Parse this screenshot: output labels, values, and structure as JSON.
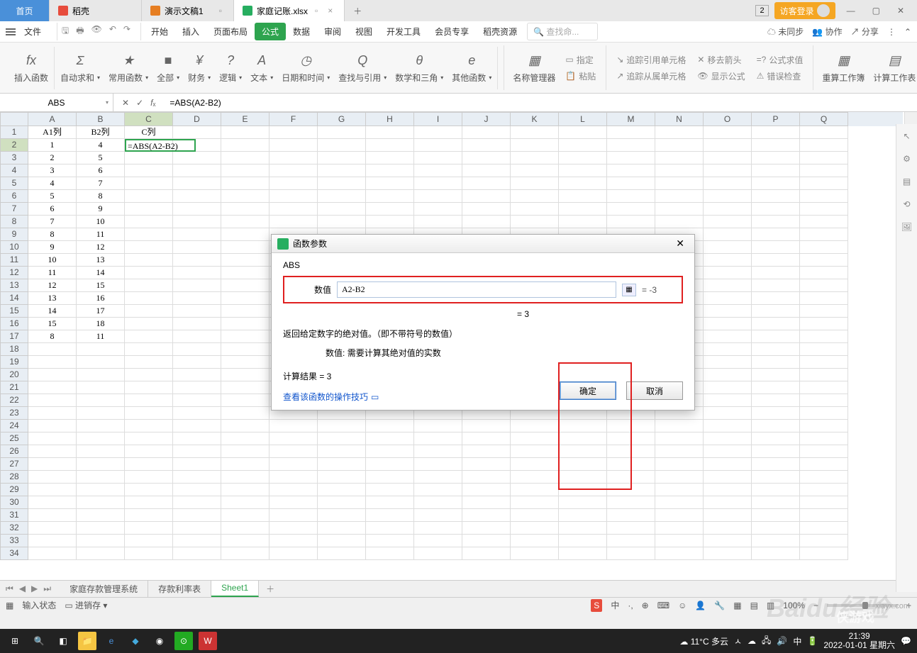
{
  "titlebar": {
    "home": "首页",
    "tabs": [
      {
        "icon": "red",
        "label": "稻壳"
      },
      {
        "icon": "orange",
        "label": "演示文稿1"
      },
      {
        "icon": "green",
        "label": "家庭记账.xlsx",
        "active": true
      }
    ],
    "badge": "2",
    "login": "访客登录"
  },
  "menubar": {
    "file": "文件",
    "items": [
      "开始",
      "插入",
      "页面布局",
      "公式",
      "数据",
      "审阅",
      "视图",
      "开发工具",
      "会员专享",
      "稻壳资源"
    ],
    "active_index": 3,
    "search_ph": "查找命...",
    "right": [
      "未同步",
      "协作",
      "分享"
    ]
  },
  "ribbon": {
    "buttons": [
      {
        "ico": "fx",
        "label": "插入函数"
      },
      {
        "ico": "Σ",
        "label": "自动求和"
      },
      {
        "ico": "★",
        "label": "常用函数"
      },
      {
        "ico": "■",
        "label": "全部"
      },
      {
        "ico": "¥",
        "label": "财务"
      },
      {
        "ico": "?",
        "label": "逻辑"
      },
      {
        "ico": "A",
        "label": "文本"
      },
      {
        "ico": "◷",
        "label": "日期和时间"
      },
      {
        "ico": "Q",
        "label": "查找与引用"
      },
      {
        "ico": "θ",
        "label": "数学和三角"
      },
      {
        "ico": "e",
        "label": "其他函数"
      }
    ],
    "name_mgr": "名称管理器",
    "small": {
      "r1": [
        "指定",
        "追踪引用单元格",
        "移去箭头",
        "公式求值"
      ],
      "r2": [
        "粘贴",
        "追踪从属单元格",
        "显示公式",
        "错误检查"
      ]
    },
    "calc": [
      "重算工作簿",
      "计算工作表"
    ]
  },
  "formula_bar": {
    "name_box": "ABS",
    "formula": "=ABS(A2-B2)"
  },
  "grid": {
    "cols": [
      "A",
      "B",
      "C",
      "D",
      "E",
      "F",
      "G",
      "H",
      "I",
      "J",
      "K",
      "L",
      "M",
      "N",
      "O",
      "P",
      "Q"
    ],
    "headers": [
      "A1列",
      "B2列",
      "C列"
    ],
    "data_a": [
      1,
      2,
      3,
      4,
      5,
      6,
      7,
      8,
      9,
      10,
      11,
      12,
      13,
      14,
      15,
      8
    ],
    "data_b": [
      4,
      5,
      6,
      7,
      8,
      9,
      10,
      11,
      12,
      13,
      14,
      15,
      16,
      17,
      18,
      11
    ],
    "c2": "=ABS(A2-B2)",
    "row_count": 34
  },
  "dialog": {
    "title": "函数参数",
    "fn": "ABS",
    "param_label": "数值",
    "param_value": "A2-B2",
    "param_eq": "= -3",
    "result_eq": "= 3",
    "desc": "返回给定数字的绝对值。（即不带符号的数值）",
    "desc2_label": "数值:",
    "desc2": "需要计算其绝对值的实数",
    "calc": "计算结果 = 3",
    "link": "查看该函数的操作技巧",
    "ok": "确定",
    "cancel": "取消"
  },
  "sheet_tabs": {
    "tabs": [
      "家庭存款管理系统",
      "存款利率表",
      "Sheet1"
    ],
    "active": 2
  },
  "status": {
    "mode": "输入状态",
    "pin": "进销存",
    "zoom": "100%"
  },
  "taskbar": {
    "weather": "11°C 多云",
    "time": "21:39",
    "date": "2022-01-01 星期六"
  },
  "wm": {
    "a": "xiayx.com",
    "b": "侠游戏",
    "c": "Baidu经验"
  }
}
